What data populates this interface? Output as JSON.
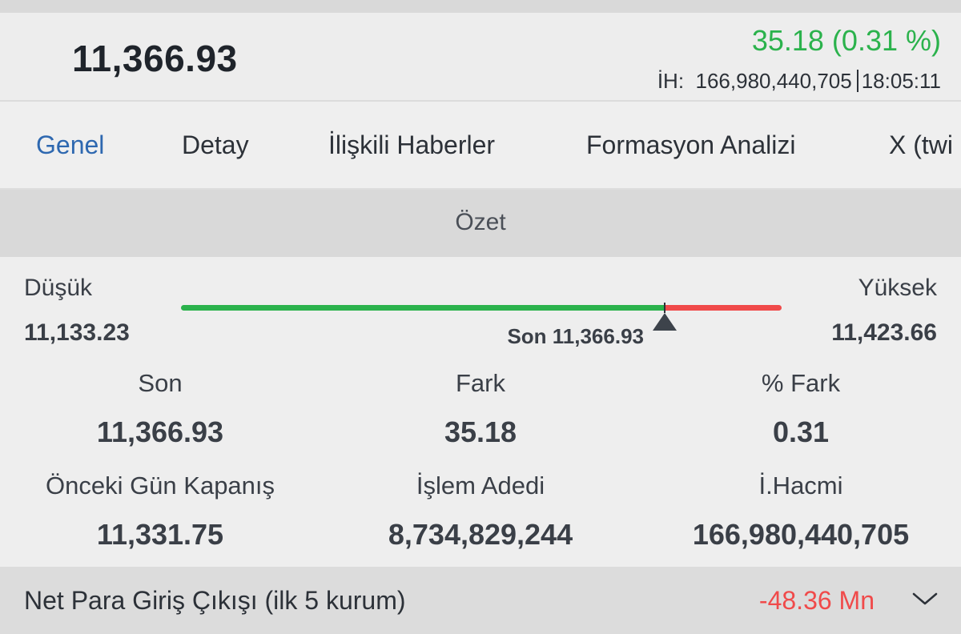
{
  "header": {
    "price": "11,366.93",
    "change": "35.18 (0.31 %)",
    "volume_label": "İH:",
    "volume": "166,980,440,705",
    "time": "18:05:11",
    "colors": {
      "positive": "#2bb24c"
    }
  },
  "tabs": [
    {
      "label": "Genel",
      "active": true
    },
    {
      "label": "Detay"
    },
    {
      "label": "İlişkili Haberler"
    },
    {
      "label": "Formasyon Analizi"
    },
    {
      "label": "X (twi"
    }
  ],
  "section": {
    "title": "Özet"
  },
  "range": {
    "low_label": "Düşük",
    "low_value": "11,133.23",
    "high_label": "Yüksek",
    "high_value": "11,423.66",
    "last_label": "Son 11,366.93",
    "low": 11133.23,
    "high": 11423.66,
    "last": 11366.93,
    "colors": {
      "below": "#2bb24c",
      "above": "#f04a4a",
      "marker": "#3d434b"
    }
  },
  "stats": {
    "son": {
      "label": "Son",
      "value": "11,366.93"
    },
    "fark": {
      "label": "Fark",
      "value": "35.18"
    },
    "pct_fark": {
      "label": "% Fark",
      "value": "0.31"
    },
    "prev_close": {
      "label": "Önceki Gün Kapanış",
      "value": "11,331.75"
    },
    "trade_count": {
      "label": "İşlem Adedi",
      "value": "8,734,829,244"
    },
    "volume": {
      "label": "İ.Hacmi",
      "value": "166,980,440,705"
    }
  },
  "footer": {
    "label": "Net Para Giriş Çıkışı (ilk 5 kurum)",
    "value": "-48.36 Mn",
    "icon": "chevron-down-icon",
    "colors": {
      "negative": "#f04a4a"
    }
  }
}
